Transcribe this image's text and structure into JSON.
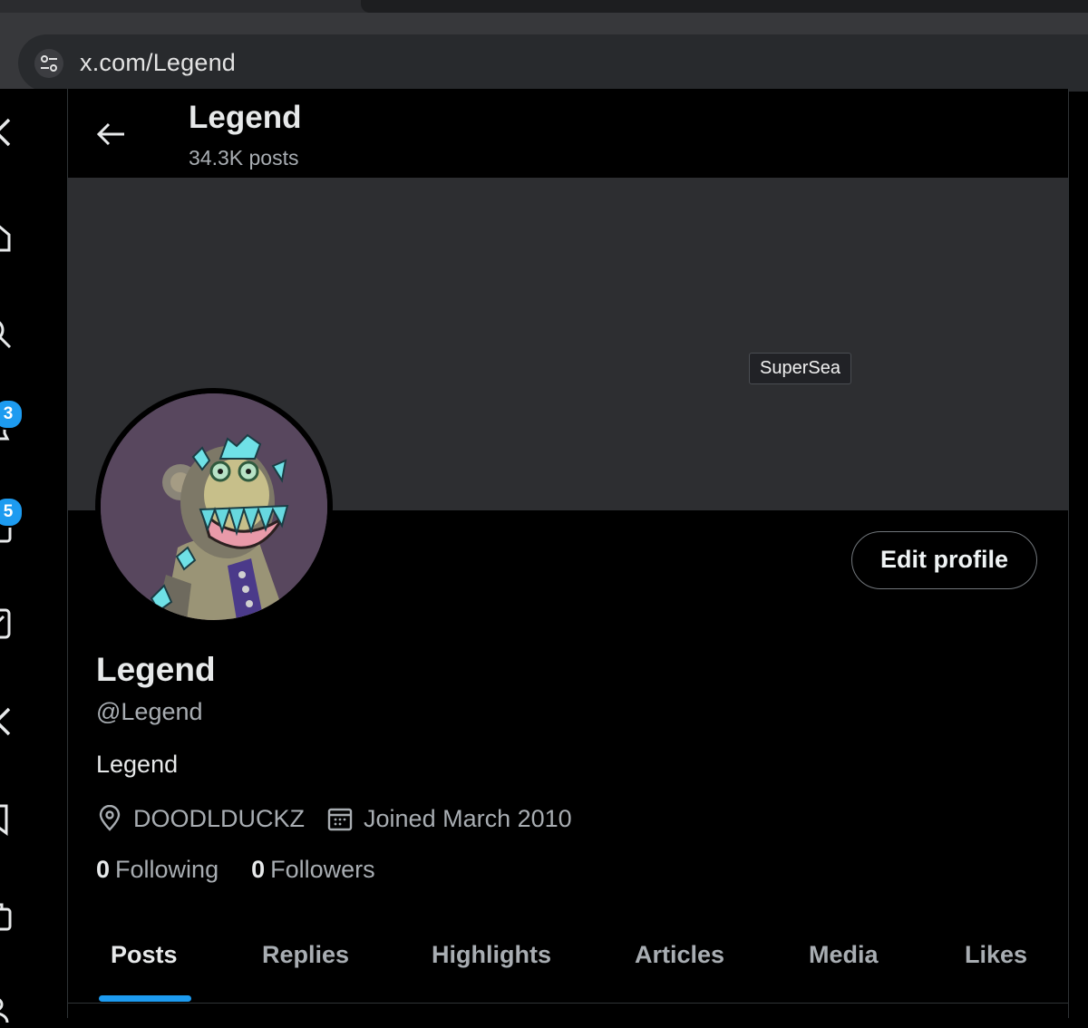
{
  "browser": {
    "url": "x.com/Legend"
  },
  "nav": {
    "notifications_badge": "3",
    "messages_badge": "5"
  },
  "header": {
    "name": "Legend",
    "posts": "34.3K posts"
  },
  "banner": {
    "tooltip": "SuperSea"
  },
  "profile": {
    "edit_label": "Edit profile",
    "name": "Legend",
    "handle": "@Legend",
    "bio": "Legend",
    "location": "DOODLDUCKZ",
    "joined": "Joined March 2010",
    "following_count": "0",
    "following_label": "Following",
    "followers_count": "0",
    "followers_label": "Followers"
  },
  "tabs": [
    {
      "label": "Posts",
      "active": true
    },
    {
      "label": "Replies"
    },
    {
      "label": "Highlights"
    },
    {
      "label": "Articles"
    },
    {
      "label": "Media"
    },
    {
      "label": "Likes"
    }
  ],
  "colors": {
    "accent": "#1d9bf0",
    "banner": "#2d2e31",
    "avatar_bg": "#58475e"
  }
}
